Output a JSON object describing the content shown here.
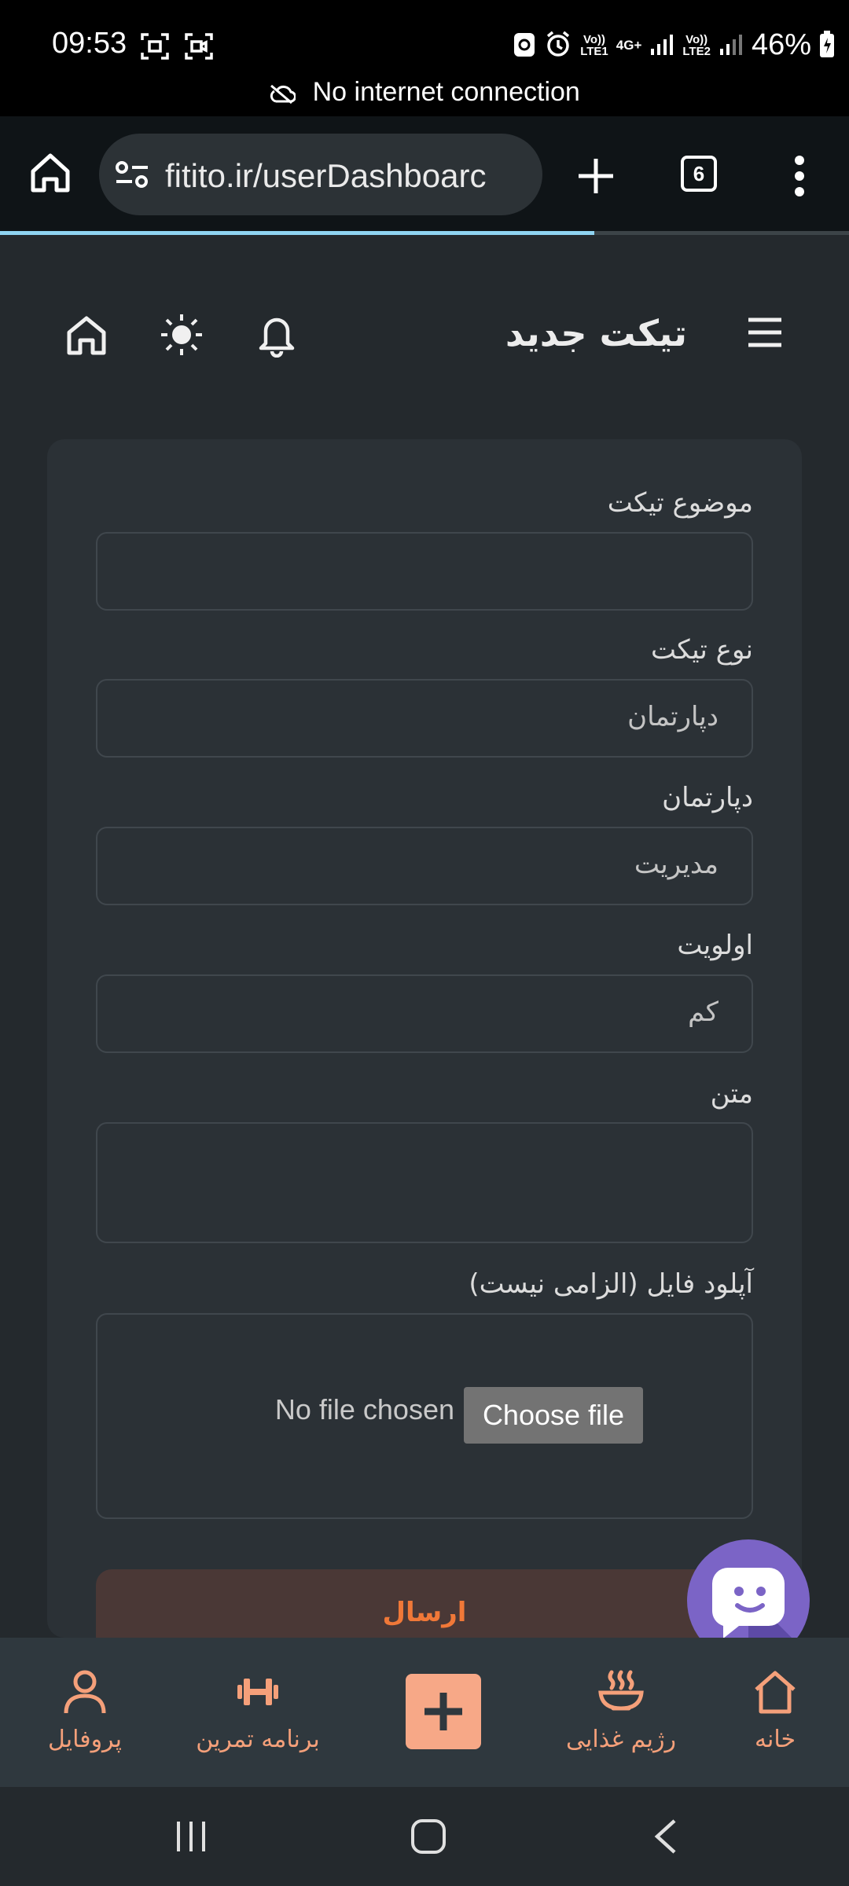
{
  "status_bar": {
    "time": "09:53",
    "battery": "46%",
    "sim1": "LTE1",
    "sim2": "LTE2",
    "network_type": "4G+",
    "offline_message": "No internet connection",
    "icons": [
      "screenshot-icon",
      "screen-record-icon",
      "cast-icon",
      "alarm-icon",
      "signal-icon",
      "battery-icon"
    ]
  },
  "browser": {
    "url": "fitito.ir/userDashboarc",
    "tab_count": "6",
    "icons": [
      "home-icon",
      "site-settings-icon",
      "new-tab-icon",
      "tabs-icon",
      "more-icon"
    ],
    "load_progress": 0.7
  },
  "app_header": {
    "title": "تیکت جدید",
    "icons": [
      "menu-icon",
      "notification-bell-icon",
      "theme-toggle-sun-icon",
      "home-icon"
    ]
  },
  "form": {
    "subject": {
      "label": "موضوع تیکت",
      "value": ""
    },
    "ticket_type": {
      "label": "نوع تیکت",
      "value": "دپارتمان"
    },
    "department": {
      "label": "دپارتمان",
      "value": "مدیریت"
    },
    "priority": {
      "label": "اولویت",
      "value": "کم"
    },
    "body": {
      "label": "متن",
      "value": ""
    },
    "upload": {
      "label": "آپلود فایل (الزامی نیست)",
      "no_file_text": "No file chosen",
      "button_label": "Choose file"
    },
    "submit_label": "ارسال"
  },
  "bottom_nav": {
    "items": [
      {
        "label": "خانه",
        "icon": "home-icon"
      },
      {
        "label": "رژیم غذایی",
        "icon": "bowl-icon"
      },
      {
        "label": "",
        "icon": "plus-icon"
      },
      {
        "label": "برنامه تمرین",
        "icon": "dumbbell-icon"
      },
      {
        "label": "پروفایل",
        "icon": "user-icon"
      }
    ],
    "accent_color": "#f5a07a"
  },
  "chat_widget": {
    "icon": "chat-smile-icon",
    "color": "#7b64c6"
  },
  "colors": {
    "page_bg": "#24292d",
    "card_bg": "#2b3136",
    "accent": "#f07838"
  }
}
